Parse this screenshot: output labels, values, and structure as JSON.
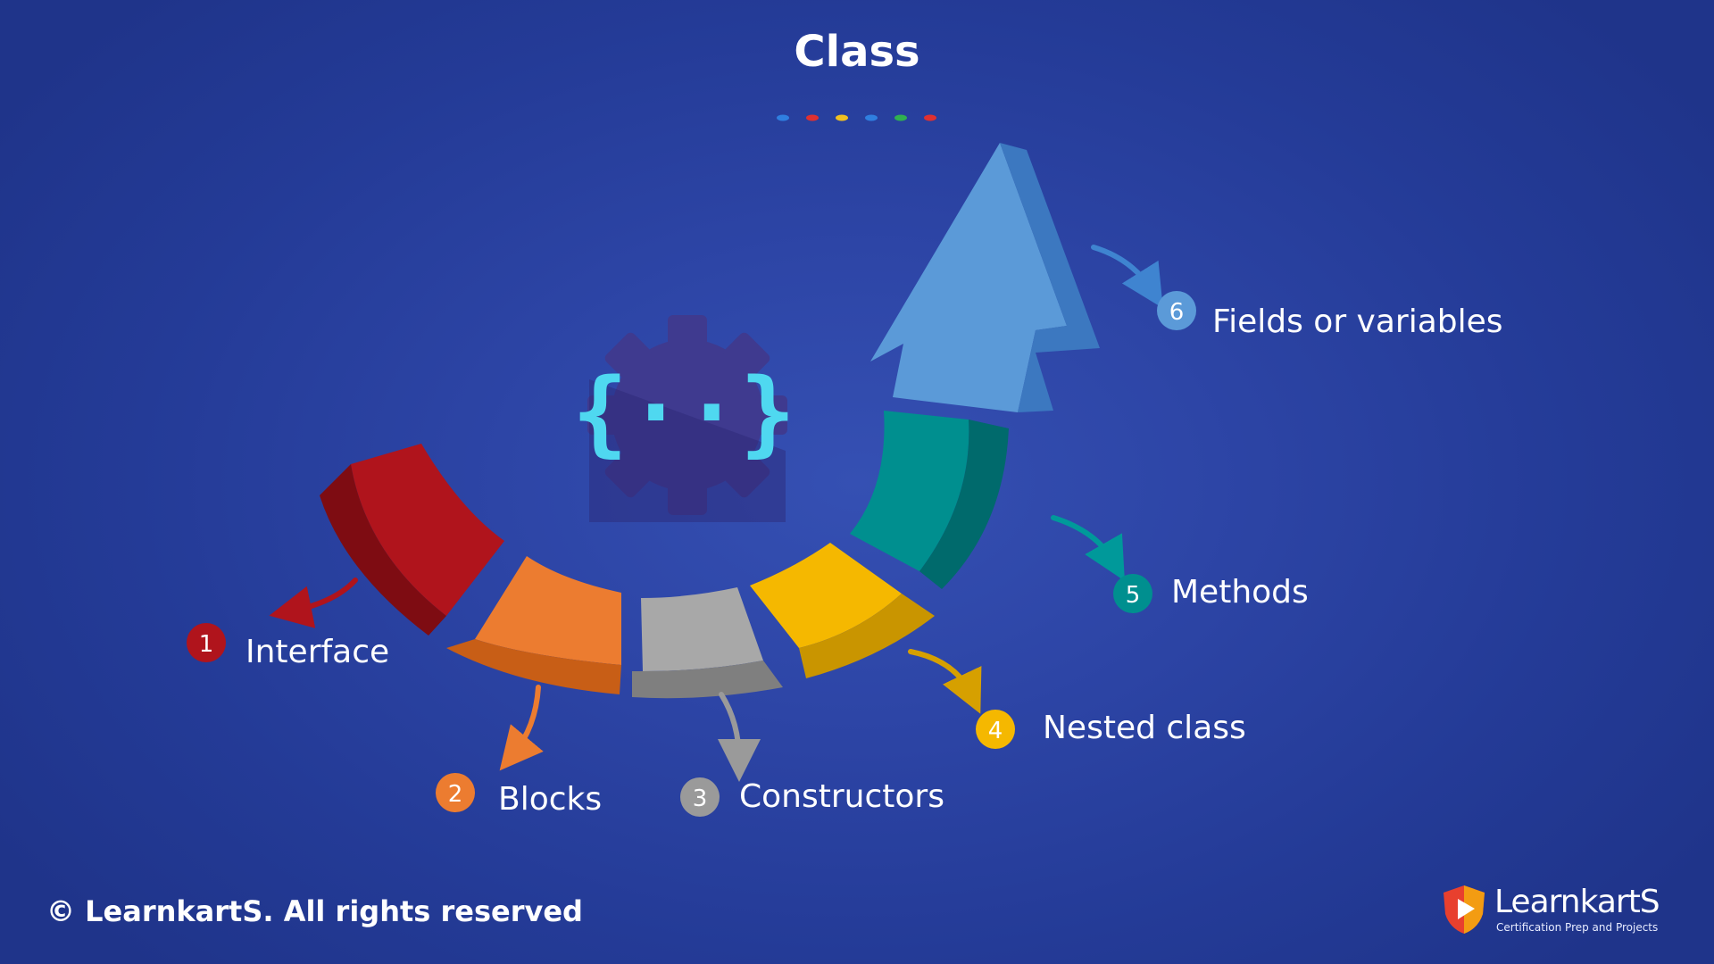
{
  "title": "Class",
  "colors": {
    "background": "#2a42a2",
    "interface": "#b0141c",
    "blocks": "#ec7c30",
    "constructors": "#a8a8a8",
    "nested_class": "#f5b800",
    "methods": "#008f8f",
    "fields": "#5b9ad8",
    "gear": "#3f3a8f",
    "braces": "#4fd8f0"
  },
  "title_dots": [
    "#2f7fe0",
    "#e03030",
    "#f0c020",
    "#2f7fe0",
    "#30b050",
    "#e03030"
  ],
  "center_icon": "gear-braces-icon",
  "items": [
    {
      "number": "1",
      "label": "Interface",
      "color": "#b0141c"
    },
    {
      "number": "2",
      "label": "Blocks",
      "color": "#ec7c30"
    },
    {
      "number": "3",
      "label": "Constructors",
      "color": "#9a9a9a"
    },
    {
      "number": "4",
      "label": "Nested class",
      "color": "#f5b800"
    },
    {
      "number": "5",
      "label": "Methods",
      "color": "#008f8f"
    },
    {
      "number": "6",
      "label": "Fields or variables",
      "color": "#5b9ad8"
    }
  ],
  "footer": {
    "copyright": "© LearnkartS. All rights reserved",
    "brand_name": "LearnkartS",
    "brand_tagline": "Certification Prep and Projects",
    "brand_icon": "shield-play-logo-icon"
  }
}
